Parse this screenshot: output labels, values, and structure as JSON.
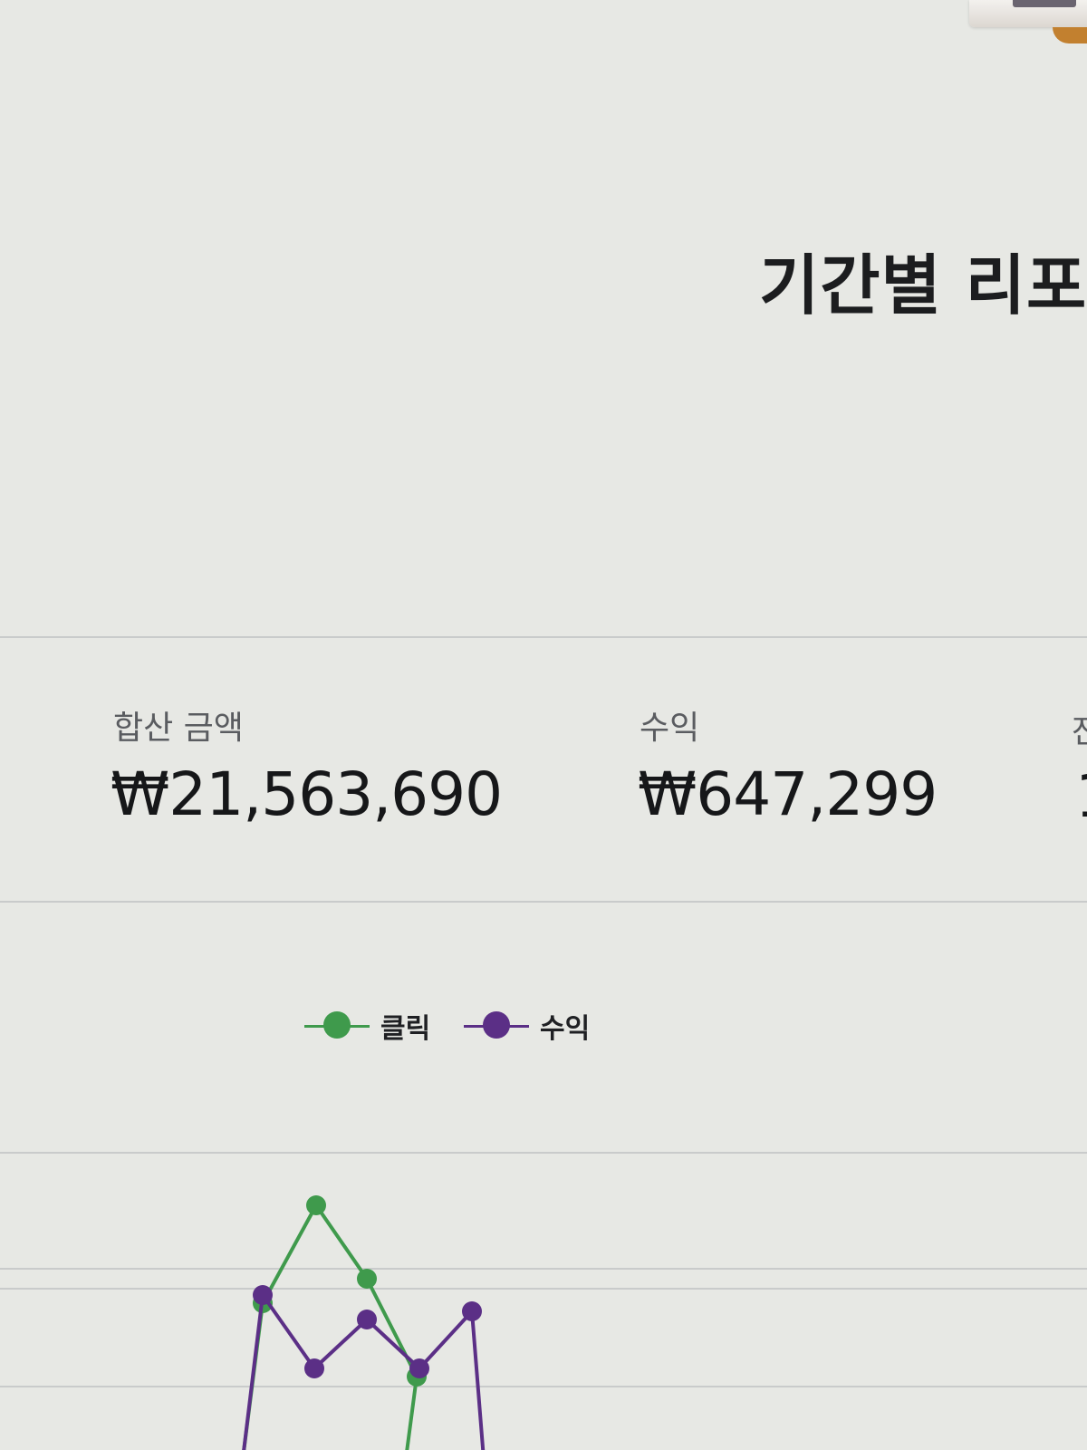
{
  "header": {
    "title": "기간별 리포"
  },
  "summary": {
    "total_amount": {
      "label": "합산 금액",
      "value": "₩21,563,690"
    },
    "revenue": {
      "label": "수익",
      "value": "₩647,299"
    },
    "third_label_partial": "잔",
    "third_value_partial": "1"
  },
  "colors": {
    "clicks": "#3f9a4c",
    "revenue": "#5b2f86",
    "background": "#e7e8e4",
    "gridline": "#c9cbcb"
  },
  "chart_data": {
    "type": "line",
    "legend": "top",
    "series": [
      {
        "name": "클릭",
        "color": "#3f9a4c",
        "values": [
          3,
          15,
          6,
          -6
        ]
      },
      {
        "name": "수익",
        "color": "#5b2f86",
        "values": [
          4,
          -5,
          1,
          -5,
          2
        ]
      }
    ],
    "grid": true
  }
}
